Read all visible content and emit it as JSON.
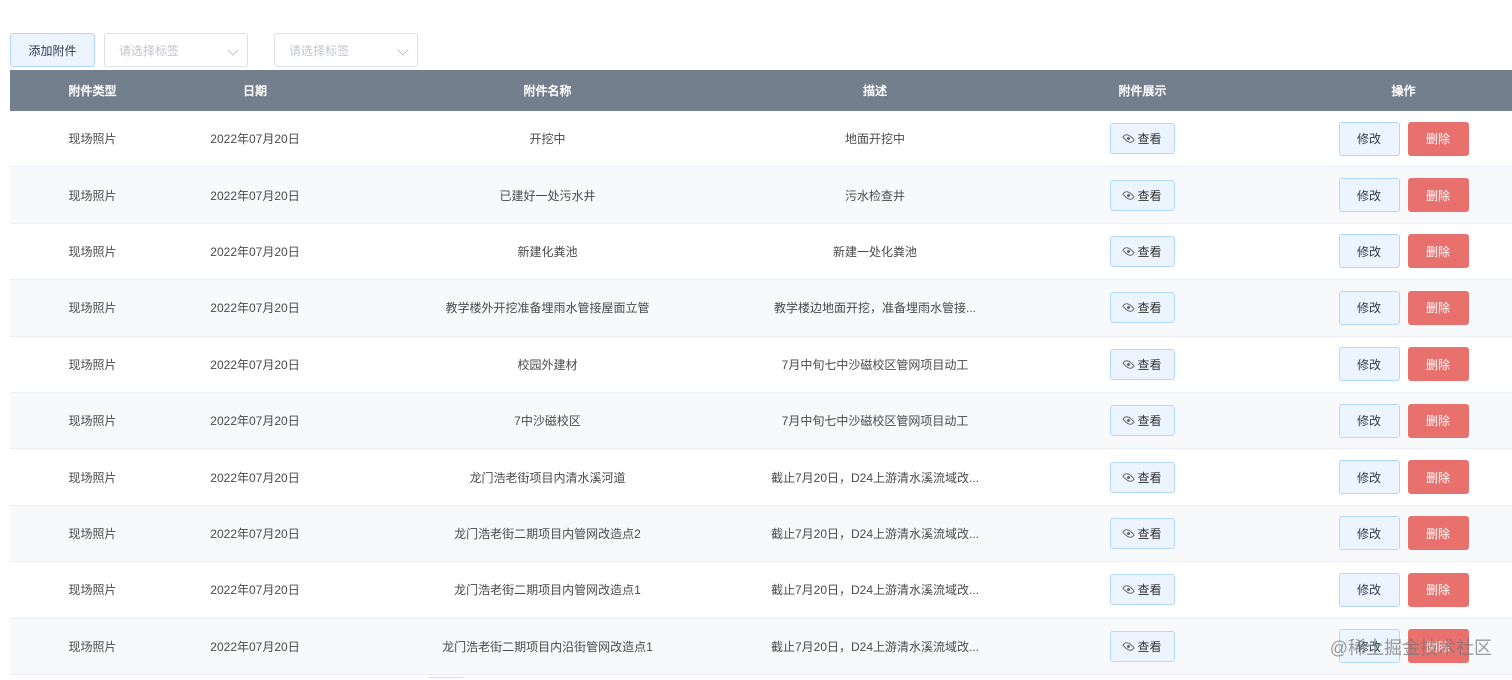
{
  "toolbar": {
    "add_label": "添加附件",
    "select1_placeholder": "请选择标签",
    "select2_placeholder": "请选择标签"
  },
  "table": {
    "headers": [
      "附件类型",
      "日期",
      "附件名称",
      "描述",
      "附件展示",
      "操作"
    ],
    "view_label": "查看",
    "edit_label": "修改",
    "delete_label": "删除",
    "rows": [
      {
        "type": "现场照片",
        "date": "2022年07月20日",
        "name": "开挖中",
        "desc": "地面开挖中"
      },
      {
        "type": "现场照片",
        "date": "2022年07月20日",
        "name": "已建好一处污水井",
        "desc": "污水检查井"
      },
      {
        "type": "现场照片",
        "date": "2022年07月20日",
        "name": "新建化粪池",
        "desc": "新建一处化粪池"
      },
      {
        "type": "现场照片",
        "date": "2022年07月20日",
        "name": "教学楼外开挖准备埋雨水管接屋面立管",
        "desc": "教学楼边地面开挖，准备埋雨水管接..."
      },
      {
        "type": "现场照片",
        "date": "2022年07月20日",
        "name": "校园外建材",
        "desc": "7月中旬七中沙磁校区管网项目动工"
      },
      {
        "type": "现场照片",
        "date": "2022年07月20日",
        "name": "7中沙磁校区",
        "desc": "7月中旬七中沙磁校区管网项目动工"
      },
      {
        "type": "现场照片",
        "date": "2022年07月20日",
        "name": "龙门浩老街项目内清水溪河道",
        "desc": "截止7月20日，D24上游清水溪流域改..."
      },
      {
        "type": "现场照片",
        "date": "2022年07月20日",
        "name": "龙门浩老街二期项目内管网改造点2",
        "desc": "截止7月20日，D24上游清水溪流域改..."
      },
      {
        "type": "现场照片",
        "date": "2022年07月20日",
        "name": "龙门浩老街二期项目内管网改造点1",
        "desc": "截止7月20日，D24上游清水溪流域改..."
      },
      {
        "type": "现场照片",
        "date": "2022年07月20日",
        "name": "龙门浩老街二期项目内沿街管网改造点1",
        "desc": "截止7月20日，D24上游清水溪流域改..."
      }
    ]
  },
  "watermark": "@稀土掘金技术社区",
  "colors": {
    "header_bg": "#737f8c",
    "delete_bg": "#e8706d",
    "button_light_bg": "#ecf5ff"
  }
}
